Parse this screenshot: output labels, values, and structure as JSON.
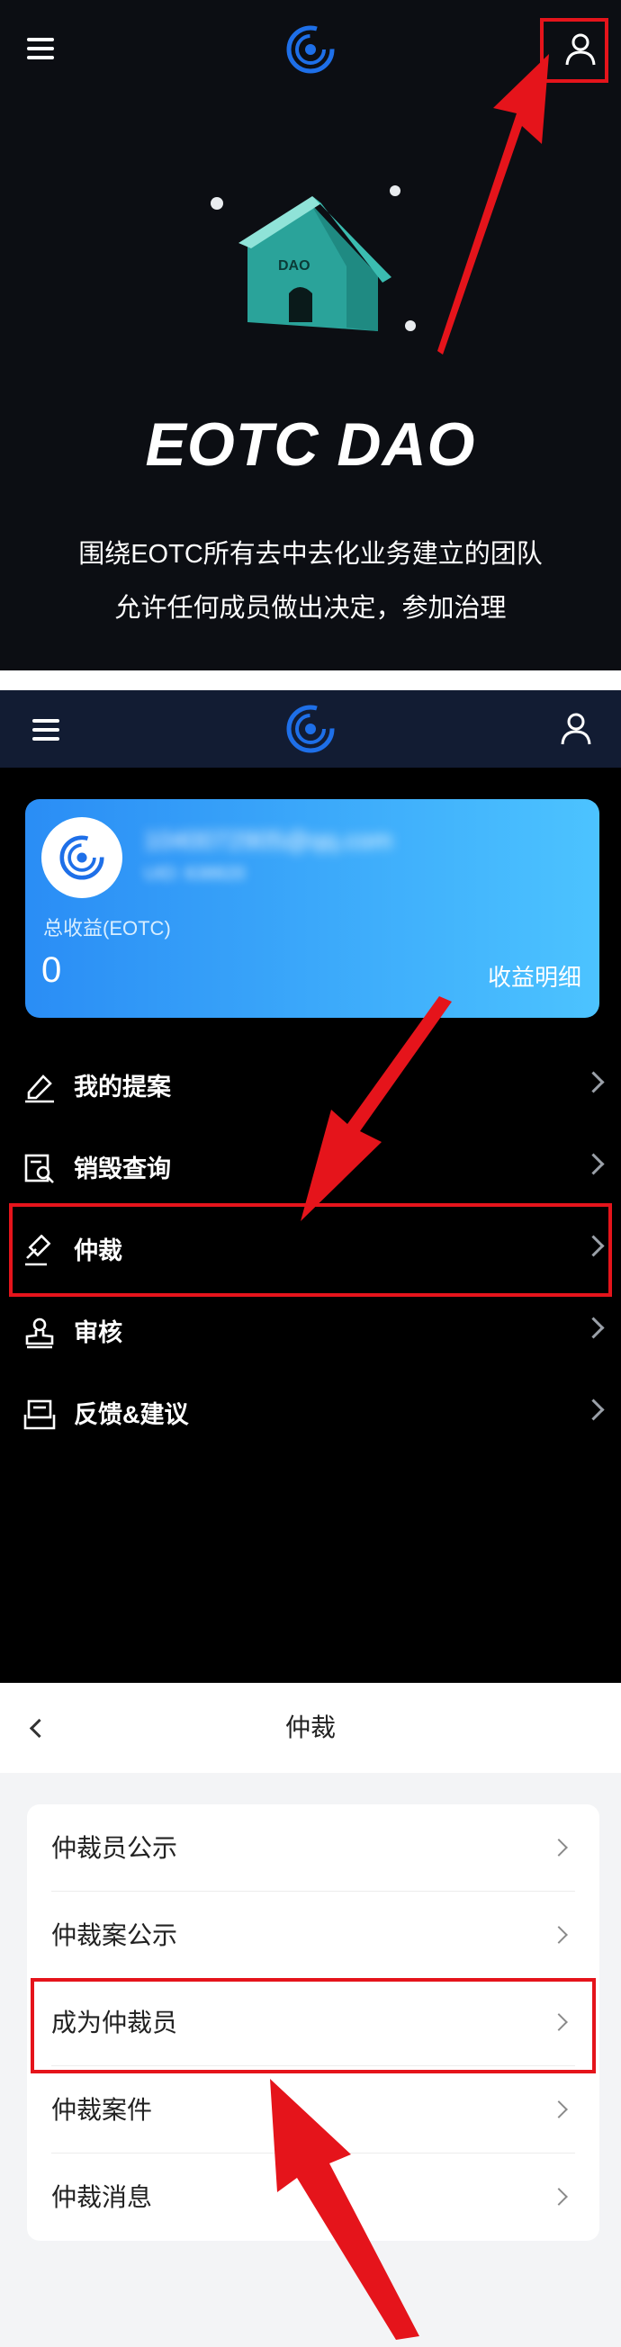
{
  "panel1": {
    "hero_title": "EOTC DAO",
    "house_sign": "DAO",
    "description_line1": "围绕EOTC所有去中去化业务建立的团队",
    "description_line2": "允许任何成员做出决定，参加治理",
    "icons": {
      "menu": "hamburger-menu-icon",
      "logo": "eotc-logo-icon",
      "user": "user-icon"
    }
  },
  "panel2": {
    "account_email": "1040072905@qq.com",
    "account_uid": "UID: 638820",
    "earnings_label": "总收益(EOTC)",
    "earnings_value": "0",
    "earnings_detail_link": "收益明细",
    "menu_items": [
      {
        "label": "我的提案",
        "icon": "proposal-icon"
      },
      {
        "label": "销毁查询",
        "icon": "burn-query-icon"
      },
      {
        "label": "仲裁",
        "icon": "gavel-icon"
      },
      {
        "label": "审核",
        "icon": "stamp-icon"
      },
      {
        "label": "反馈&建议",
        "icon": "feedback-icon"
      }
    ],
    "accent_gradient": [
      "#2a8df5",
      "#4cc3ff"
    ]
  },
  "panel3": {
    "title": "仲裁",
    "items": [
      {
        "label": "仲裁员公示"
      },
      {
        "label": "仲裁案公示"
      },
      {
        "label": "成为仲裁员"
      },
      {
        "label": "仲裁案件"
      },
      {
        "label": "仲裁消息"
      }
    ]
  },
  "colors": {
    "highlight": "#e5141b",
    "brand": "#1e6fe8"
  }
}
